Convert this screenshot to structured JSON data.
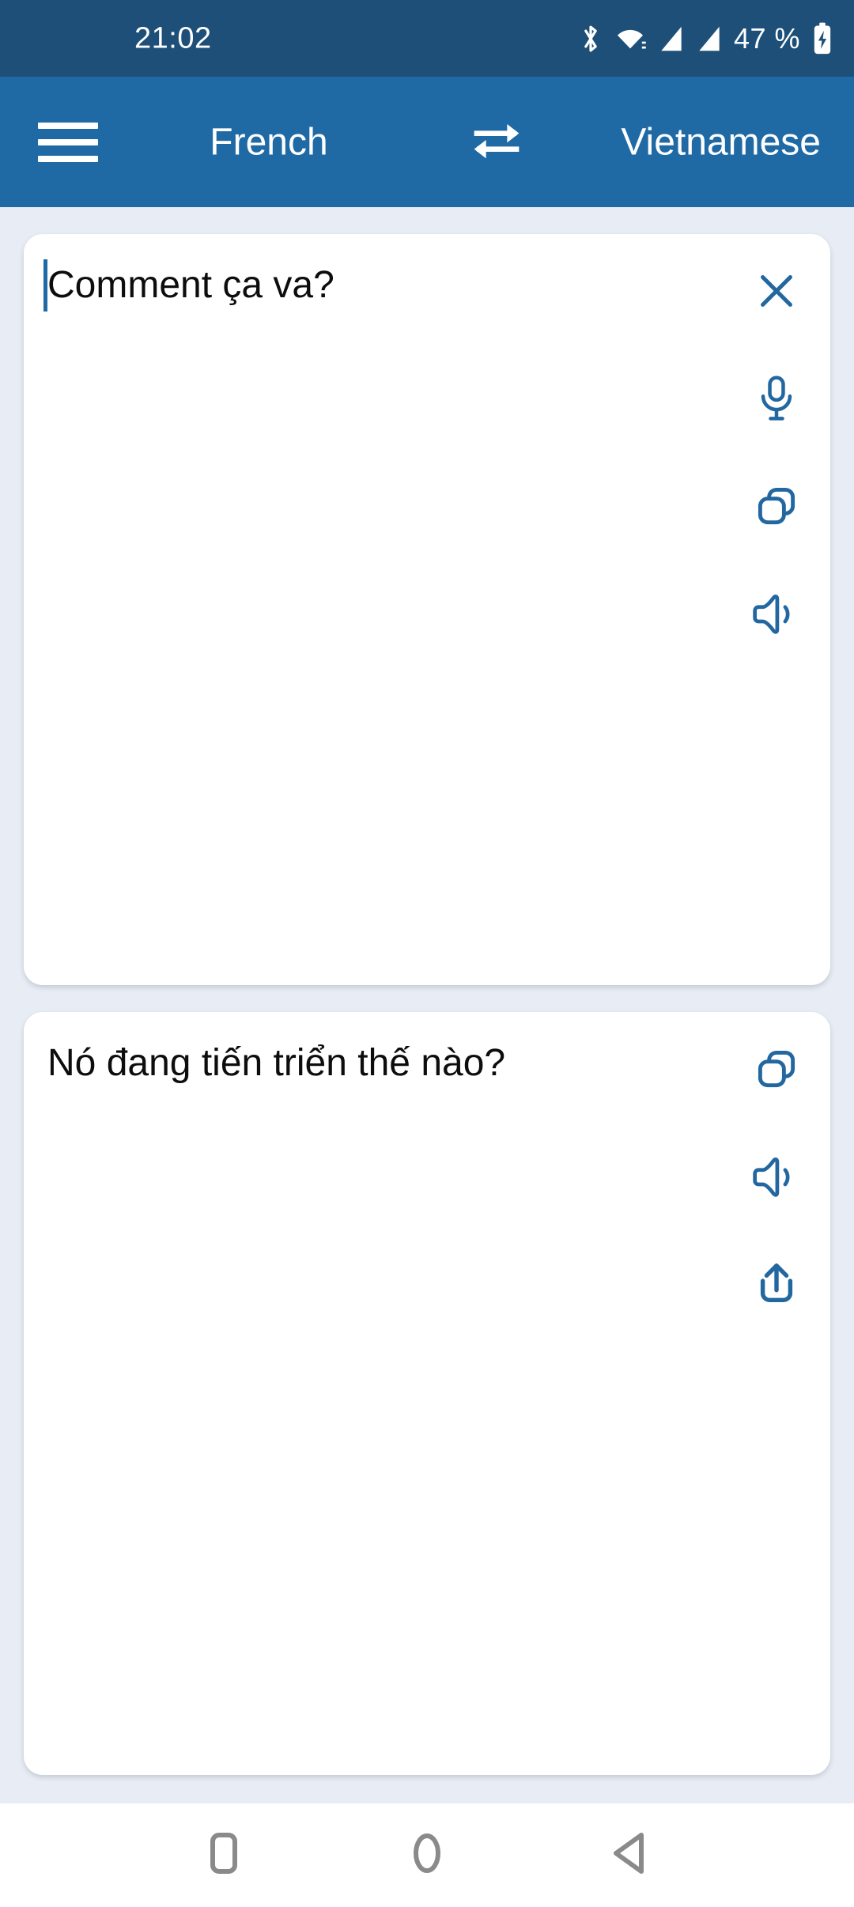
{
  "status_bar": {
    "time": "21:02",
    "battery_text": "47 %",
    "icons": [
      "bluetooth-icon",
      "wifi-icon",
      "signal-icon-1",
      "signal-icon-2",
      "battery-charging-icon"
    ],
    "background_color": "#1d4f78"
  },
  "app_bar": {
    "menu_label": "menu-icon",
    "source_language": "French",
    "swap_label": "swap-icon",
    "target_language": "Vietnamese",
    "background_color": "#1f6aa5"
  },
  "source_card": {
    "text": "Comment ça va?",
    "caret_visible": true,
    "actions": [
      {
        "name": "clear-button",
        "icon": "close-icon"
      },
      {
        "name": "microphone-button",
        "icon": "microphone-icon"
      },
      {
        "name": "copy-button",
        "icon": "copy-icon"
      },
      {
        "name": "speak-button",
        "icon": "speaker-icon"
      }
    ]
  },
  "target_card": {
    "text": "Nó đang tiến triển thế nào?",
    "actions": [
      {
        "name": "copy-button",
        "icon": "copy-icon"
      },
      {
        "name": "speak-button",
        "icon": "speaker-icon"
      },
      {
        "name": "share-button",
        "icon": "share-icon"
      }
    ]
  },
  "nav_bar": {
    "recent_label": "recents-icon",
    "home_label": "home-icon",
    "back_label": "back-icon"
  },
  "colors": {
    "accent": "#1f6aa5",
    "icon_blue": "#2367a0",
    "page_background": "#e8edf5",
    "card_background": "#ffffff",
    "nav_icon_gray": "#8a8a8a"
  }
}
